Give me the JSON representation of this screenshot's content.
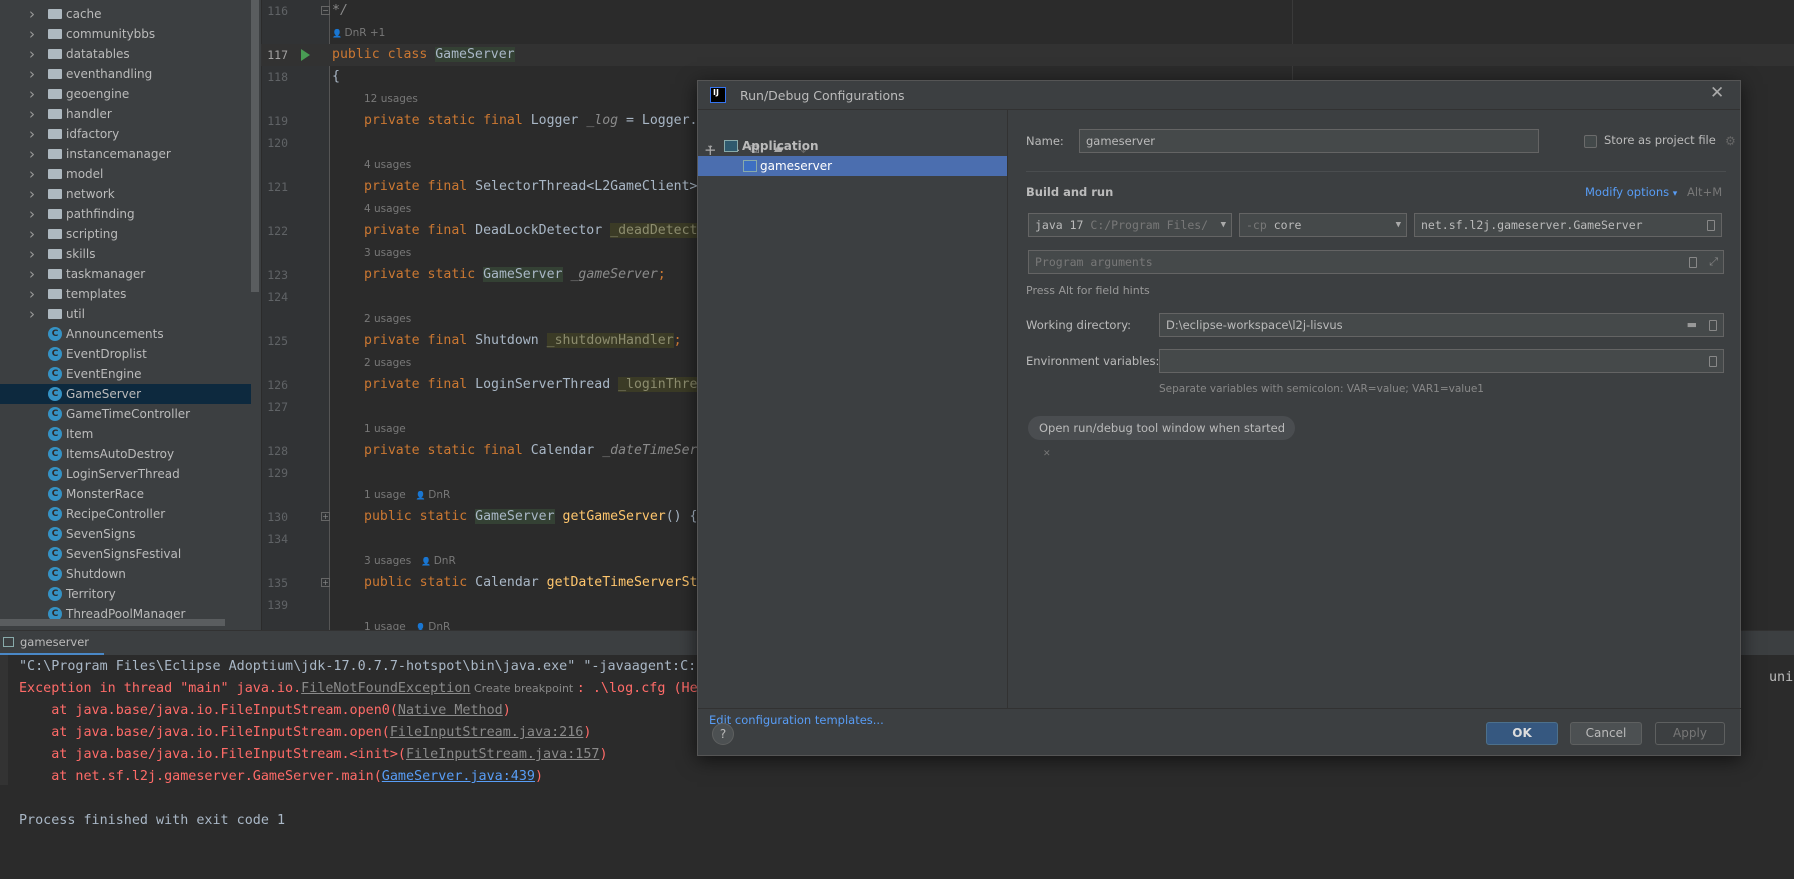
{
  "project_tree": {
    "folders": [
      "cache",
      "communitybbs",
      "datatables",
      "eventhandling",
      "geoengine",
      "handler",
      "idfactory",
      "instancemanager",
      "model",
      "network",
      "pathfinding",
      "scripting",
      "skills",
      "taskmanager",
      "templates",
      "util"
    ],
    "classes": [
      "Announcements",
      "EventDroplist",
      "EventEngine",
      "GameServer",
      "GameTimeController",
      "Item",
      "ItemsAutoDestroy",
      "LoginServerThread",
      "MonsterRace",
      "RecipeController",
      "SevenSigns",
      "SevenSignsFestival",
      "Shutdown",
      "Territory",
      "ThreadPoolManager"
    ],
    "selected": "GameServer"
  },
  "editor": {
    "rows": [
      {
        "num": "116",
        "fold": true,
        "indent": 0,
        "tokens": [
          [
            "*/",
            "fld"
          ]
        ]
      },
      {
        "hint": "DnR +1",
        "author": true,
        "indent": 0
      },
      {
        "num": "117",
        "run": true,
        "current": true,
        "indent": 0,
        "tokens": [
          [
            "public class ",
            "kw"
          ],
          [
            "GameServer",
            "hlg"
          ]
        ]
      },
      {
        "num": "118",
        "indent": 0,
        "tokens": [
          [
            "{",
            "pl"
          ]
        ]
      },
      {
        "hint": "12 usages",
        "indent": 1
      },
      {
        "num": "119",
        "indent": 1,
        "tokens": [
          [
            "private static final ",
            "kw"
          ],
          [
            "Logger ",
            "pl"
          ],
          [
            "_log",
            "fld"
          ],
          [
            " = Logger.",
            "pl"
          ]
        ]
      },
      {
        "num": "120"
      },
      {
        "hint": "4 usages",
        "indent": 1
      },
      {
        "num": "121",
        "indent": 1,
        "tokens": [
          [
            "private final ",
            "kw"
          ],
          [
            "SelectorThread<L2GameClient>",
            "pl"
          ]
        ]
      },
      {
        "hint": "4 usages",
        "indent": 1
      },
      {
        "num": "122",
        "indent": 1,
        "tokens": [
          [
            "private final ",
            "kw"
          ],
          [
            "DeadLockDetector ",
            "pl"
          ],
          [
            "_deadDetect",
            "hly"
          ]
        ]
      },
      {
        "hint": "3 usages",
        "indent": 1
      },
      {
        "num": "123",
        "indent": 1,
        "tokens": [
          [
            "private static ",
            "kw"
          ],
          [
            "GameServer",
            "hlg"
          ],
          [
            " ",
            "pl"
          ],
          [
            "_gameServer",
            "fld"
          ],
          [
            ";",
            "kw"
          ]
        ]
      },
      {
        "num": "124"
      },
      {
        "hint": "2 usages",
        "indent": 1
      },
      {
        "num": "125",
        "indent": 1,
        "tokens": [
          [
            "private final ",
            "kw"
          ],
          [
            "Shutdown ",
            "pl"
          ],
          [
            "_shutdownHandler",
            "hly"
          ],
          [
            ";",
            "kw"
          ]
        ]
      },
      {
        "hint": "2 usages",
        "indent": 1
      },
      {
        "num": "126",
        "indent": 1,
        "tokens": [
          [
            "private final ",
            "kw"
          ],
          [
            "LoginServerThread ",
            "pl"
          ],
          [
            "_loginThre",
            "hly"
          ]
        ]
      },
      {
        "num": "127"
      },
      {
        "hint": "1 usage",
        "indent": 1
      },
      {
        "num": "128",
        "indent": 1,
        "tokens": [
          [
            "private static final ",
            "kw"
          ],
          [
            "Calendar ",
            "pl"
          ],
          [
            "_dateTimeSer",
            "fld"
          ]
        ]
      },
      {
        "num": "129"
      },
      {
        "hint": "1 usage",
        "author_name": "DnR",
        "indent": 1
      },
      {
        "num": "130",
        "fold": true,
        "indent": 1,
        "tokens": [
          [
            "public static ",
            "kw"
          ],
          [
            "GameServer",
            "hlg"
          ],
          [
            " ",
            "pl"
          ],
          [
            "getGameServer",
            "mth"
          ],
          [
            "() {",
            "pl"
          ]
        ]
      },
      {
        "num": "134"
      },
      {
        "hint": "3 usages",
        "author_name": "DnR",
        "indent": 1
      },
      {
        "num": "135",
        "fold": true,
        "indent": 1,
        "tokens": [
          [
            "public static ",
            "kw"
          ],
          [
            "Calendar ",
            "pl"
          ],
          [
            "getDateTimeServerSt",
            "mth"
          ]
        ]
      },
      {
        "num": "139"
      },
      {
        "hint": "1 usage",
        "author_name": "DnR",
        "indent": 1
      }
    ]
  },
  "console": {
    "tab_label": "gameserver",
    "lines": [
      [
        [
          "\"C:\\Program Files\\Eclipse Adoptium\\jdk-17.0.7.7-hotspot\\bin\\java.exe\" \"-javaagent:C:\\",
          "pl"
        ]
      ],
      [
        [
          "Exception in thread \"main\" java.io.",
          "err"
        ],
        [
          "FileNotFoundException",
          "lnk"
        ],
        [
          " Create breakpoint ",
          "cbp"
        ],
        [
          ": .\\log.cfg (He",
          "err"
        ]
      ],
      [
        [
          "    at java.base/java.io.FileInputStream.open0(",
          "err"
        ],
        [
          "Native Method",
          "lnk"
        ],
        [
          ")",
          "err"
        ]
      ],
      [
        [
          "    at java.base/java.io.FileInputStream.open(",
          "err"
        ],
        [
          "FileInputStream.java:216",
          "lnk"
        ],
        [
          ")",
          "err"
        ]
      ],
      [
        [
          "    at java.base/java.io.FileInputStream.<init>(",
          "err"
        ],
        [
          "FileInputStream.java:157",
          "lnk"
        ],
        [
          ")",
          "err"
        ]
      ],
      [
        [
          "    at net.sf.l2j.gameserver.GameServer.main(",
          "err"
        ],
        [
          "GameServer.java:439",
          "blink"
        ],
        [
          ")",
          "err"
        ]
      ],
      [],
      [
        [
          "Process finished with exit code 1",
          "pl"
        ]
      ]
    ],
    "right_fragment": "unity E"
  },
  "dialog": {
    "title": "Run/Debug Configurations",
    "logo_text": "IJ",
    "toolbar": [
      "add-icon",
      "remove-icon",
      "copy-icon",
      "new-folder-icon",
      "sort-icon"
    ],
    "tree": {
      "group": "Application",
      "item": "gameserver"
    },
    "edit_templates": "Edit configuration templates...",
    "name_label": "Name:",
    "name_value": "gameserver",
    "store_label": "Store as project file",
    "store_checked": false,
    "section_title": "Build and run",
    "modify_options": "Modify options",
    "modify_shortcut": "Alt+M",
    "jre": {
      "name": "java 17",
      "path": "C:/Program Files/"
    },
    "classpath": {
      "prefix": "-cp",
      "value": "core"
    },
    "main_class": "net.sf.l2j.gameserver.GameServer",
    "program_args_placeholder": "Program arguments",
    "alt_hint": "Press Alt for field hints",
    "workdir_label": "Working directory:",
    "workdir_value": "D:\\eclipse-workspace\\l2j-lisvus",
    "env_label": "Environment variables:",
    "env_value": "",
    "env_hint": "Separate variables with semicolon: VAR=value; VAR1=value1",
    "chip": "Open run/debug tool window when started",
    "ok": "OK",
    "cancel": "Cancel",
    "apply": "Apply",
    "help": "?",
    "accent": "#4b6eaf"
  }
}
